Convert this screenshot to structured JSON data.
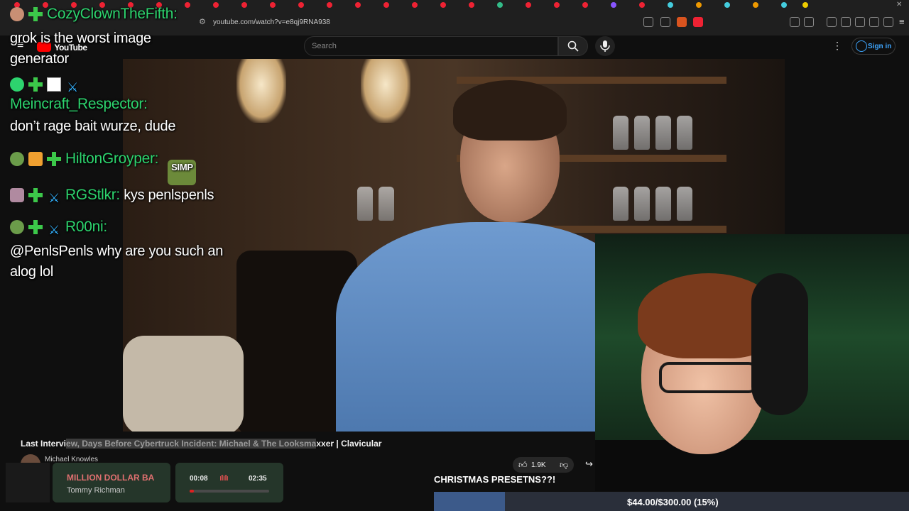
{
  "browser": {
    "url": "youtube.com/watch?v=e8qj9RNA938"
  },
  "youtube": {
    "logo_label": "YouTube",
    "search_placeholder": "Search",
    "signin_label": "Sign in",
    "video_title_before": "Last Intervi",
    "video_title_highlight": "ew, Days Before Cybertruck Incident: Michael & The Looksma",
    "video_title_after": "xxer | Clavicular",
    "channel_name": "Michael Knowles",
    "likes": "1.9K"
  },
  "chat": [
    {
      "user": "CozyClownTheFifth:",
      "message": "grok is the worst image generator"
    },
    {
      "user": "Meincraft_Respector:",
      "message": "don’t rage bait wurze, dude"
    },
    {
      "user": "HiltonGroyper:",
      "message": ""
    },
    {
      "user": "RGStlkr:",
      "message": "kys penlspenls"
    },
    {
      "user": "R00ni:",
      "message": "@PenlsPenls why are you such an alog lol"
    }
  ],
  "emote_label": "SIMP",
  "music": {
    "song": "MILLION DOLLAR BA",
    "artist": "Tommy Richman",
    "elapsed": "00:08",
    "duration": "02:35",
    "progress": 0.05
  },
  "overlay": {
    "banner": "CHRISTMAS PRESETNS??!",
    "goal_text": "$44.00/$300.00 (15%)",
    "goal_progress": 0.15
  },
  "colors": {
    "username": "#2dd46e",
    "accent_link": "#3ea6ff",
    "progress_red": "#e02020"
  }
}
